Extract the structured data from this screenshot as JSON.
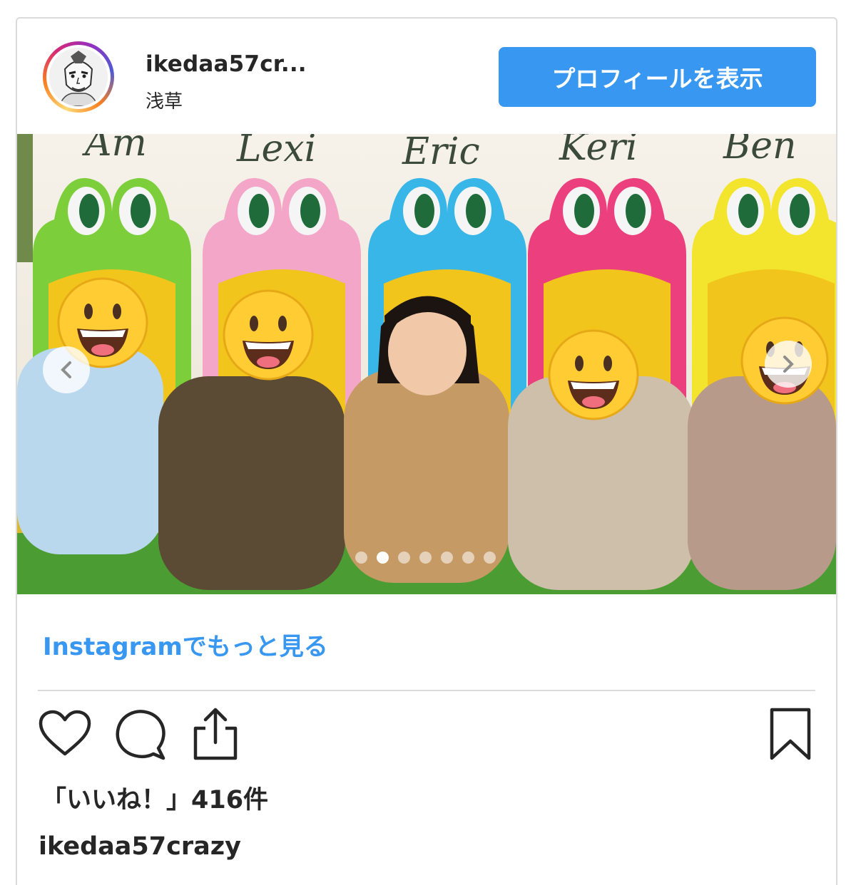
{
  "post": {
    "username": "ikedaa57cr...",
    "location": "浅草",
    "profile_button": "プロフィールを表示",
    "more_link": "Instagramでもっと見る",
    "likes_text": "「いいね！」416件",
    "owner_username": "ikedaa57crazy"
  },
  "photo": {
    "sign_names": [
      "Lexi",
      "Eric",
      "Keri",
      "Ben"
    ],
    "seat_colors": [
      "#7ccf3a",
      "#f3a6c8",
      "#39b6e8",
      "#ec3f7e",
      "#f3e52d"
    ],
    "carousel_total": 7,
    "carousel_active": 2
  },
  "icons": {
    "like": "heart-icon",
    "comment": "comment-icon",
    "share": "share-icon",
    "save": "bookmark-icon"
  },
  "colors": {
    "accent": "#3897f0",
    "text": "#262626",
    "border": "#dbdbdb"
  }
}
